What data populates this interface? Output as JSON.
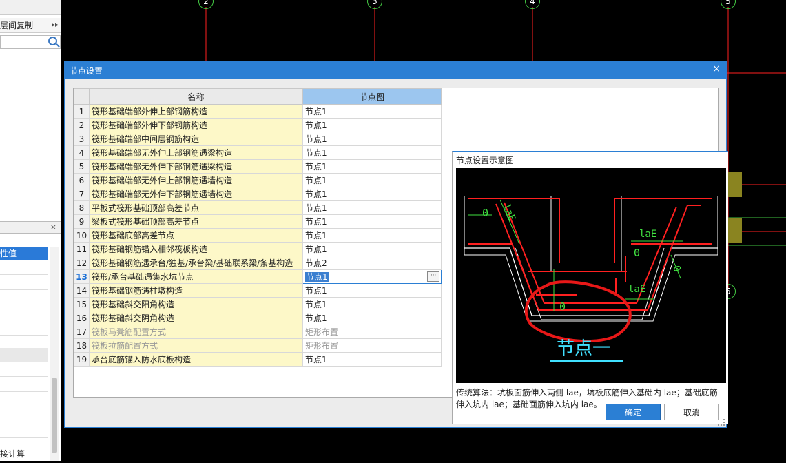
{
  "left_panel": {
    "copy_label": "层间复制",
    "more_glyph": "▸▸",
    "search_placeholder": "",
    "prop_header": "性值",
    "calc_label": "接计算",
    "close_glyph": "×"
  },
  "dialog": {
    "title": "节点设置",
    "close_glyph": "×",
    "columns": {
      "name": "名称",
      "node": "节点图"
    },
    "rows": [
      {
        "no": "1",
        "name": "筏形基础端部外伸上部钢筋构造",
        "value": "节点1"
      },
      {
        "no": "2",
        "name": "筏形基础端部外伸下部钢筋构造",
        "value": "节点1"
      },
      {
        "no": "3",
        "name": "筏形基础端部中间层钢筋构造",
        "value": "节点1"
      },
      {
        "no": "4",
        "name": "筏形基础端部无外伸上部钢筋遇梁构造",
        "value": "节点1"
      },
      {
        "no": "5",
        "name": "筏形基础端部无外伸下部钢筋遇梁构造",
        "value": "节点1"
      },
      {
        "no": "6",
        "name": "筏形基础端部无外伸上部钢筋遇墙构造",
        "value": "节点1"
      },
      {
        "no": "7",
        "name": "筏形基础端部无外伸下部钢筋遇墙构造",
        "value": "节点1"
      },
      {
        "no": "8",
        "name": "平板式筏形基础顶部高差节点",
        "value": "节点1"
      },
      {
        "no": "9",
        "name": "梁板式筏形基础顶部高差节点",
        "value": "节点1"
      },
      {
        "no": "10",
        "name": "筏形基础底部高差节点",
        "value": "节点1"
      },
      {
        "no": "11",
        "name": "筏形基础钢筋锚入相邻筏板构造",
        "value": "节点1"
      },
      {
        "no": "12",
        "name": "筏形基础钢筋遇承台/独基/承台梁/基础联系梁/条基构造",
        "value": "节点2"
      },
      {
        "no": "13",
        "name": "筏形/承台基础遇集水坑节点",
        "value": "节点1",
        "editing": true
      },
      {
        "no": "14",
        "name": "筏形基础钢筋遇柱墩构造",
        "value": "节点1"
      },
      {
        "no": "15",
        "name": "筏形基础斜交阳角构造",
        "value": "节点1"
      },
      {
        "no": "16",
        "name": "筏形基础斜交阴角构造",
        "value": "节点1"
      },
      {
        "no": "17",
        "name": "筏板马凳筋配置方式",
        "value": "矩形布置",
        "dim": true
      },
      {
        "no": "18",
        "name": "筏板拉筋配置方式",
        "value": "矩形布置",
        "dim": true
      },
      {
        "no": "19",
        "name": "承台底筋锚入防水底板构造",
        "value": "节点1"
      }
    ],
    "preview": {
      "header": "节点设置示意图",
      "diagram_title": "节点一",
      "labels": {
        "lae": "laE",
        "zero": "0"
      },
      "description": "传统算法：坑板面筋伸入两侧 lae，坑板底筋伸入基础内 lae；基础底筋伸入坑内 lae；基础面筋伸入坑内 lae。"
    },
    "buttons": {
      "ok": "确定",
      "cancel": "取消"
    },
    "ellipsis": "···"
  },
  "cad": {
    "axes": [
      "2",
      "3",
      "4",
      "5"
    ],
    "axis_side": "5"
  },
  "colors": {
    "dialog_blue": "#2b7fd4",
    "name_cell_bg": "#fdf8c8",
    "header_selected": "#9cc6ef",
    "rebar_red": "#ff2020",
    "dimension_green": "#40e040",
    "highlight_circle": "#e81818",
    "title_cyan": "#40e0ff"
  }
}
